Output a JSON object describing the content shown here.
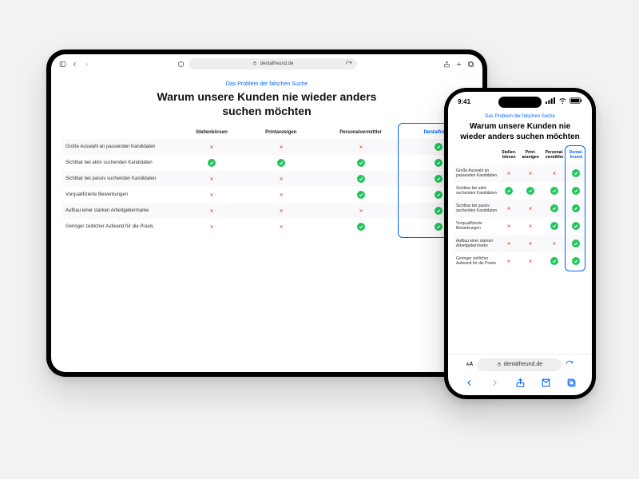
{
  "brand_color": "#0066ff",
  "domain": "dentalfreund.de",
  "ipad": {
    "address_prefix": "🔒",
    "eyebrow": "Das Problem der falschen Suche",
    "title": "Warum unsere Kunden nie wieder anders suchen möchten"
  },
  "iphone": {
    "time": "9:41",
    "eyebrow": "Das Problem der falschen Suche",
    "title": "Warum unsere Kunden nie wieder anders suchen möchten",
    "addr_text_size": "AA"
  },
  "table": {
    "columns": [
      "",
      "Stellenbörsen",
      "Printanzeigen",
      "Personalvermittler",
      "Dentalfreund"
    ],
    "columns_short": [
      "",
      "Stellen-\nbörsen",
      "Print-\nanzeigen",
      "Personal-\nvermittler",
      "Dental-\nfreund"
    ],
    "rows": [
      {
        "label": "Große Auswahl an passenden Kandidaten",
        "cells": [
          false,
          false,
          false,
          true
        ]
      },
      {
        "label": "Sichtbar bei aktiv suchenden Kandidaten",
        "cells": [
          true,
          true,
          true,
          true
        ]
      },
      {
        "label": "Sichtbar bei passiv suchenden Kandidaten",
        "cells": [
          false,
          false,
          true,
          true
        ]
      },
      {
        "label": "Vorqualifizierte Bewerbungen",
        "cells": [
          false,
          false,
          true,
          true
        ]
      },
      {
        "label": "Aufbau einer starken Arbeitgebermarke",
        "cells": [
          false,
          false,
          false,
          true
        ]
      },
      {
        "label": "Geringer zeitlicher Aufwand für die Praxis",
        "cells": [
          false,
          false,
          true,
          true
        ]
      }
    ]
  }
}
